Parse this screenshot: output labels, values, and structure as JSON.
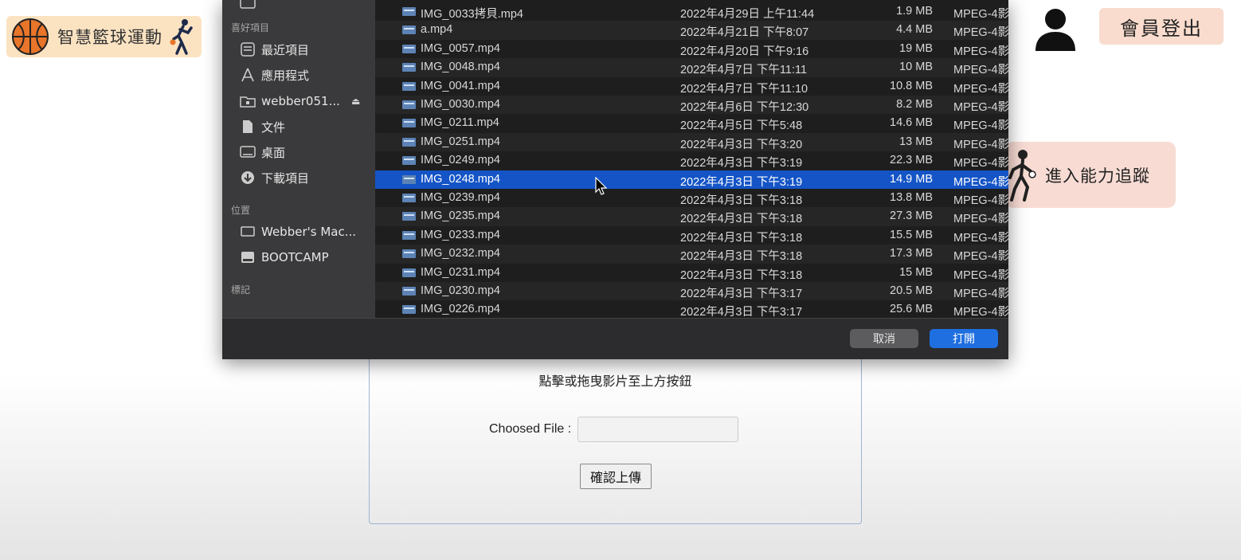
{
  "header": {
    "site_title": "智慧籃球運動",
    "logout_label": "會員登出",
    "ability_label": "進入能力追蹤"
  },
  "upload": {
    "hint": "點擊或拖曳影片至上方按鈕",
    "chosen_label": "Choosed File :",
    "chosen_value": "",
    "confirm_label": "確認上傳"
  },
  "dialog": {
    "sidebar": {
      "favorites_heading": "喜好項目",
      "favorites": [
        {
          "label": "最近項目",
          "icon": "recents-icon"
        },
        {
          "label": "應用程式",
          "icon": "applications-icon"
        },
        {
          "label": "webber051...",
          "icon": "folder-icon"
        },
        {
          "label": "文件",
          "icon": "documents-icon"
        },
        {
          "label": "桌面",
          "icon": "desktop-icon"
        },
        {
          "label": "下載項目",
          "icon": "downloads-icon"
        }
      ],
      "locations_heading": "位置",
      "locations": [
        {
          "label": "Webber's Mac...",
          "icon": "laptop-icon"
        },
        {
          "label": "BOOTCAMP",
          "icon": "drive-icon"
        }
      ],
      "tags_heading": "標記"
    },
    "files": [
      {
        "name": "IMG_0033拷貝.mp4",
        "date": "2022年4月29日 上午11:44",
        "size": "1.9 MB",
        "kind": "MPEG-4影"
      },
      {
        "name": "a.mp4",
        "date": "2022年4月21日 下午8:07",
        "size": "4.4 MB",
        "kind": "MPEG-4影"
      },
      {
        "name": "IMG_0057.mp4",
        "date": "2022年4月20日 下午9:16",
        "size": "19 MB",
        "kind": "MPEG-4影"
      },
      {
        "name": "IMG_0048.mp4",
        "date": "2022年4月7日 下午11:11",
        "size": "10 MB",
        "kind": "MPEG-4影"
      },
      {
        "name": "IMG_0041.mp4",
        "date": "2022年4月7日 下午11:10",
        "size": "10.8 MB",
        "kind": "MPEG-4影"
      },
      {
        "name": "IMG_0030.mp4",
        "date": "2022年4月6日 下午12:30",
        "size": "8.2 MB",
        "kind": "MPEG-4影"
      },
      {
        "name": "IMG_0211.mp4",
        "date": "2022年4月5日 下午5:48",
        "size": "14.6 MB",
        "kind": "MPEG-4影"
      },
      {
        "name": "IMG_0251.mp4",
        "date": "2022年4月3日 下午3:20",
        "size": "13 MB",
        "kind": "MPEG-4影"
      },
      {
        "name": "IMG_0249.mp4",
        "date": "2022年4月3日 下午3:19",
        "size": "22.3 MB",
        "kind": "MPEG-4影"
      },
      {
        "name": "IMG_0248.mp4",
        "date": "2022年4月3日 下午3:19",
        "size": "14.9 MB",
        "kind": "MPEG-4影",
        "selected": true
      },
      {
        "name": "IMG_0239.mp4",
        "date": "2022年4月3日 下午3:18",
        "size": "13.8 MB",
        "kind": "MPEG-4影"
      },
      {
        "name": "IMG_0235.mp4",
        "date": "2022年4月3日 下午3:18",
        "size": "27.3 MB",
        "kind": "MPEG-4影"
      },
      {
        "name": "IMG_0233.mp4",
        "date": "2022年4月3日 下午3:18",
        "size": "15.5 MB",
        "kind": "MPEG-4影"
      },
      {
        "name": "IMG_0232.mp4",
        "date": "2022年4月3日 下午3:18",
        "size": "17.3 MB",
        "kind": "MPEG-4影"
      },
      {
        "name": "IMG_0231.mp4",
        "date": "2022年4月3日 下午3:18",
        "size": "15 MB",
        "kind": "MPEG-4影"
      },
      {
        "name": "IMG_0230.mp4",
        "date": "2022年4月3日 下午3:17",
        "size": "20.5 MB",
        "kind": "MPEG-4影"
      },
      {
        "name": "IMG_0226.mp4",
        "date": "2022年4月3日 下午3:17",
        "size": "25.6 MB",
        "kind": "MPEG-4影"
      }
    ],
    "cancel_label": "取消",
    "open_label": "打開"
  },
  "colors": {
    "selection": "#1454c6",
    "open_button": "#1f6fe0",
    "logo_bg": "#fbe3c2",
    "logout_bg": "#f9dccd",
    "ability_bg": "#f8dcd4"
  }
}
